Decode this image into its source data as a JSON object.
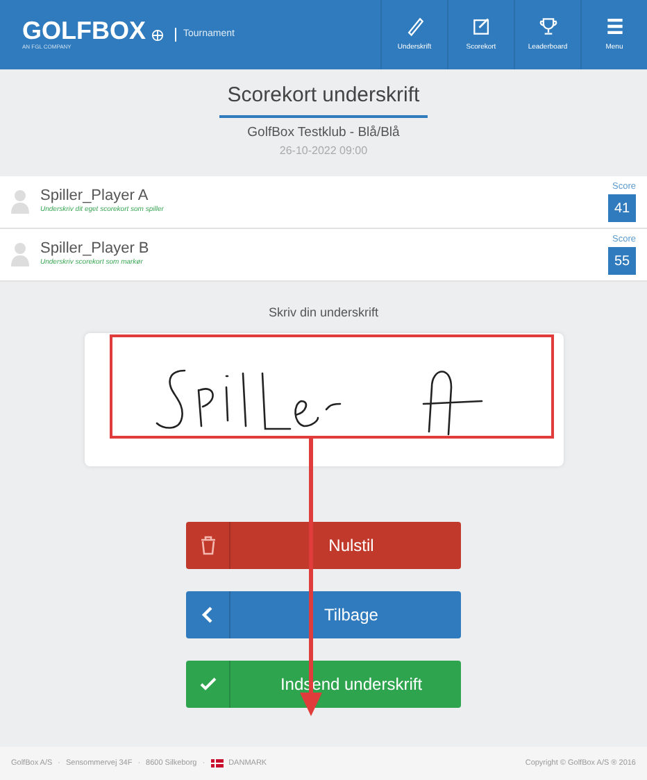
{
  "header": {
    "logo": "GOLFBOX",
    "logo_tagline": "AN FGL COMPANY",
    "section": "Tournament",
    "nav": [
      {
        "label": "Underskrift"
      },
      {
        "label": "Scorekort"
      },
      {
        "label": "Leaderboard"
      },
      {
        "label": "Menu"
      }
    ]
  },
  "title": "Scorekort underskrift",
  "club": "GolfBox Testklub - Blå/Blå",
  "date": "26-10-2022 09:00",
  "players": [
    {
      "name": "Spiller_Player A",
      "note": "Underskriv dit eget scorekort som spiller",
      "score_label": "Score",
      "score": "41"
    },
    {
      "name": "Spiller_Player B",
      "note": "Underskriv scorekort som markør",
      "score_label": "Score",
      "score": "55"
    }
  ],
  "signature_prompt": "Skriv din underskrift",
  "buttons": [
    {
      "label": "Nulstil",
      "kind": "reset"
    },
    {
      "label": "Tilbage",
      "kind": "back"
    },
    {
      "label": "Indsend underskrift",
      "kind": "submit"
    }
  ],
  "footer": {
    "address": [
      "GolfBox A/S",
      "·",
      "Sensommervej 34F",
      "·",
      "8600 Silkeborg",
      "·"
    ],
    "country": "DANMARK",
    "copyright": "Copyright © GolfBox A/S ® 2016"
  }
}
